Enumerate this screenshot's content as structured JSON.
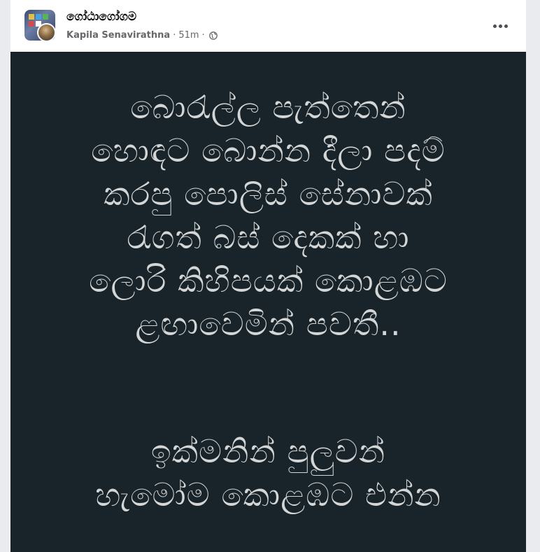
{
  "post": {
    "page_name": "ගෝඨාගෝගම",
    "author": "Kapila Senavirathna",
    "separator": "·",
    "time": "51m",
    "privacy_icon": "globe-icon",
    "more_icon": "more-options-icon",
    "image_text": {
      "block1": [
        "බොරැල්ල පැත්තෙන්",
        "හොඳට බොන්න දීලා පදම්",
        "කරපු පොලිස් සේනාවක්",
        "රැගත් බස් දෙකක් හා",
        "ලොරි කිහිපයක් කොළඹට",
        "ළඟාවෙමින් පවතී.."
      ],
      "block2": [
        "ඉක්මනින් පුලුවන්",
        "හැමෝම කොළඹට එන්න"
      ]
    }
  },
  "colors": {
    "page_background": "#e9ebee",
    "card_background": "#ffffff",
    "image_background": "#18242a",
    "image_text": "#d4d6d6",
    "meta_text": "#65676b"
  }
}
